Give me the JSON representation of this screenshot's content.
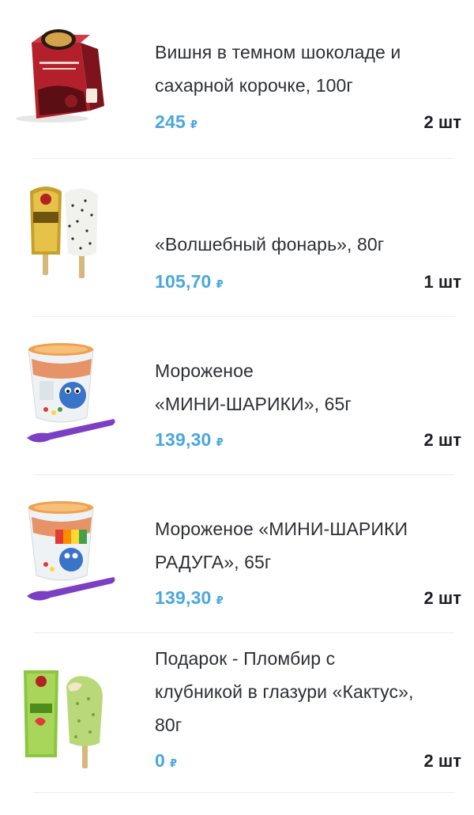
{
  "currency_symbol": "₽",
  "accent_color": "#4aa8db",
  "items": [
    {
      "name_lines": [
        "Вишня в темном шоколаде и",
        "сахарной корочке, 100г"
      ],
      "price": "245",
      "quantity": "2 шт",
      "image_icon": "cherry-chocolate-box-icon"
    },
    {
      "name_lines": [
        "«Волшебный фонарь», 80г"
      ],
      "price": "105,70",
      "quantity": "1 шт",
      "image_icon": "popsicle-pair-icon"
    },
    {
      "name_lines": [
        "Мороженое",
        "«МИНИ-ШАРИКИ», 65г"
      ],
      "price": "139,30",
      "quantity": "2 шт",
      "image_icon": "ice-cream-cup-icon"
    },
    {
      "name_lines": [
        "Мороженое «МИНИ-ШАРИКИ",
        "РАДУГА», 65г"
      ],
      "price": "139,30",
      "quantity": "2 шт",
      "image_icon": "ice-cream-cup-rainbow-icon"
    },
    {
      "name_lines": [
        "Подарок - Пломбир с",
        "клубникой в глазури «Кактус»,",
        "80г"
      ],
      "price": "0",
      "quantity": "2 шт",
      "image_icon": "cactus-popsicle-icon"
    }
  ]
}
